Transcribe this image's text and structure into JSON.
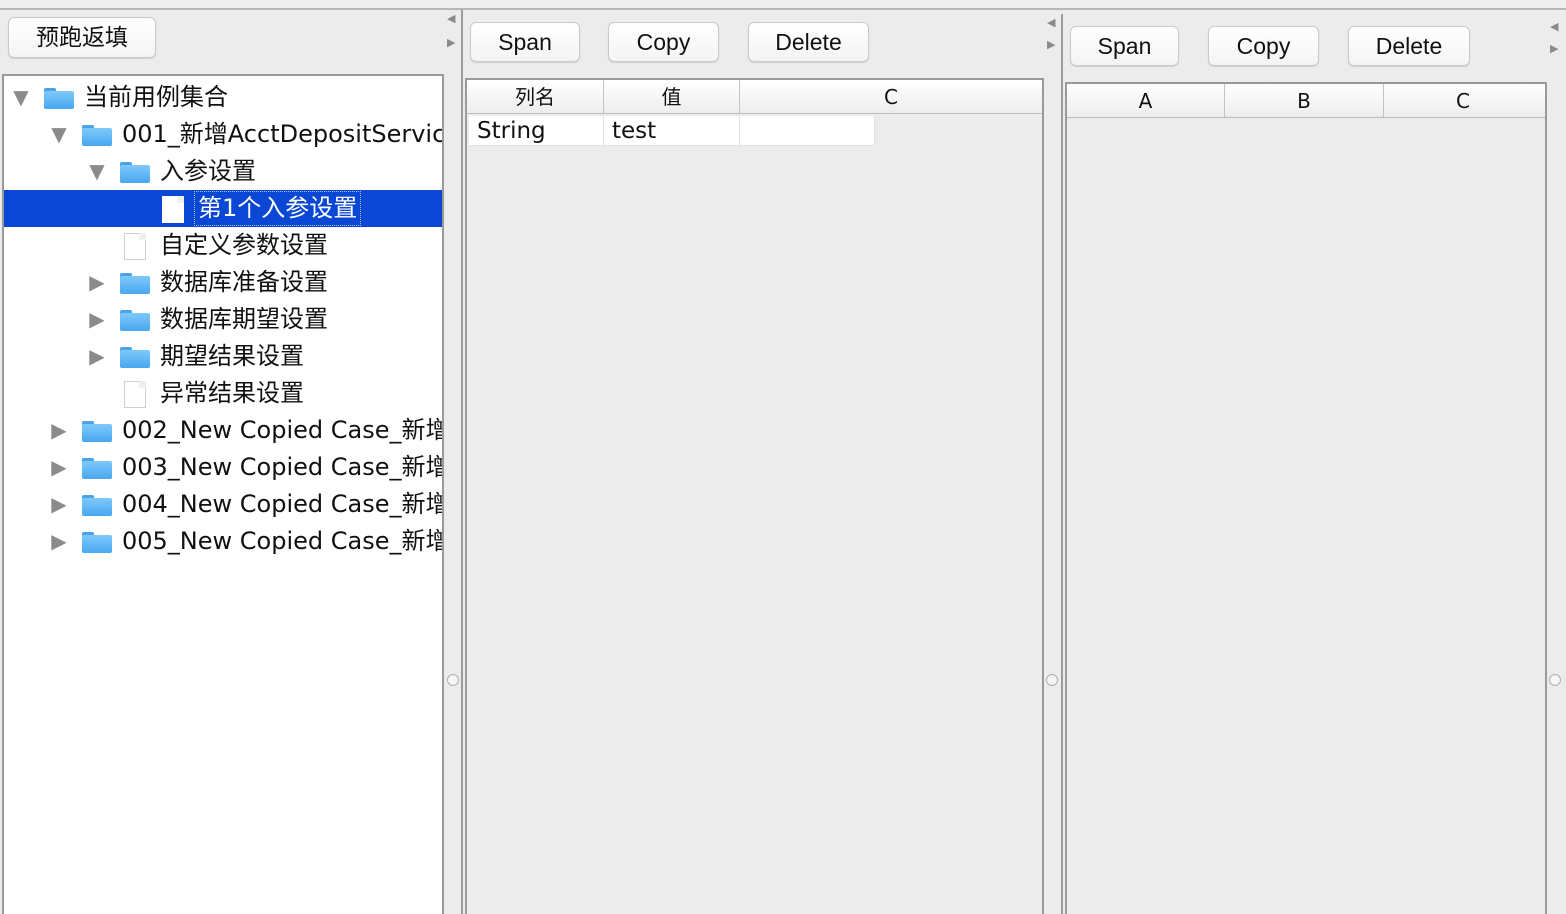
{
  "left_panel": {
    "prerun_button": "预跑返填",
    "tree": [
      {
        "label": "当前用例集合",
        "type": "folder",
        "expanded": true,
        "level": 0
      },
      {
        "label": "001_新增AcctDepositServic",
        "type": "folder",
        "expanded": true,
        "level": 1
      },
      {
        "label": "入参设置",
        "type": "folder",
        "expanded": true,
        "level": 2
      },
      {
        "label": "第1个入参设置",
        "type": "file",
        "selected": true,
        "level": 3
      },
      {
        "label": "自定义参数设置",
        "type": "file",
        "level": 2
      },
      {
        "label": "数据库准备设置",
        "type": "folder",
        "expanded": false,
        "level": 2
      },
      {
        "label": "数据库期望设置",
        "type": "folder",
        "expanded": false,
        "level": 2
      },
      {
        "label": "期望结果设置",
        "type": "folder",
        "expanded": false,
        "level": 2
      },
      {
        "label": "异常结果设置",
        "type": "file",
        "level": 2
      },
      {
        "label": "002_New Copied Case_新增",
        "type": "folder",
        "expanded": false,
        "level": 1
      },
      {
        "label": "003_New Copied Case_新增",
        "type": "folder",
        "expanded": false,
        "level": 1
      },
      {
        "label": "004_New Copied Case_新增",
        "type": "folder",
        "expanded": false,
        "level": 1
      },
      {
        "label": "005_New Copied Case_新增",
        "type": "folder",
        "expanded": false,
        "level": 1
      }
    ]
  },
  "middle_panel": {
    "toolbar": {
      "span": "Span",
      "copy": "Copy",
      "delete": "Delete"
    },
    "columns": [
      "列名",
      "值",
      "C"
    ],
    "rows": [
      [
        "String",
        "test",
        ""
      ]
    ]
  },
  "right_panel": {
    "toolbar": {
      "span": "Span",
      "copy": "Copy",
      "delete": "Delete"
    },
    "columns": [
      "A",
      "B",
      "C"
    ],
    "rows": []
  },
  "colors": {
    "selection": "#0a47d4",
    "folder": "#5fb6f5",
    "background": "#ececec"
  },
  "icons": {
    "expanded": "triangle-down-icon",
    "collapsed": "triangle-right-icon",
    "folder": "folder-icon",
    "file": "file-icon"
  }
}
